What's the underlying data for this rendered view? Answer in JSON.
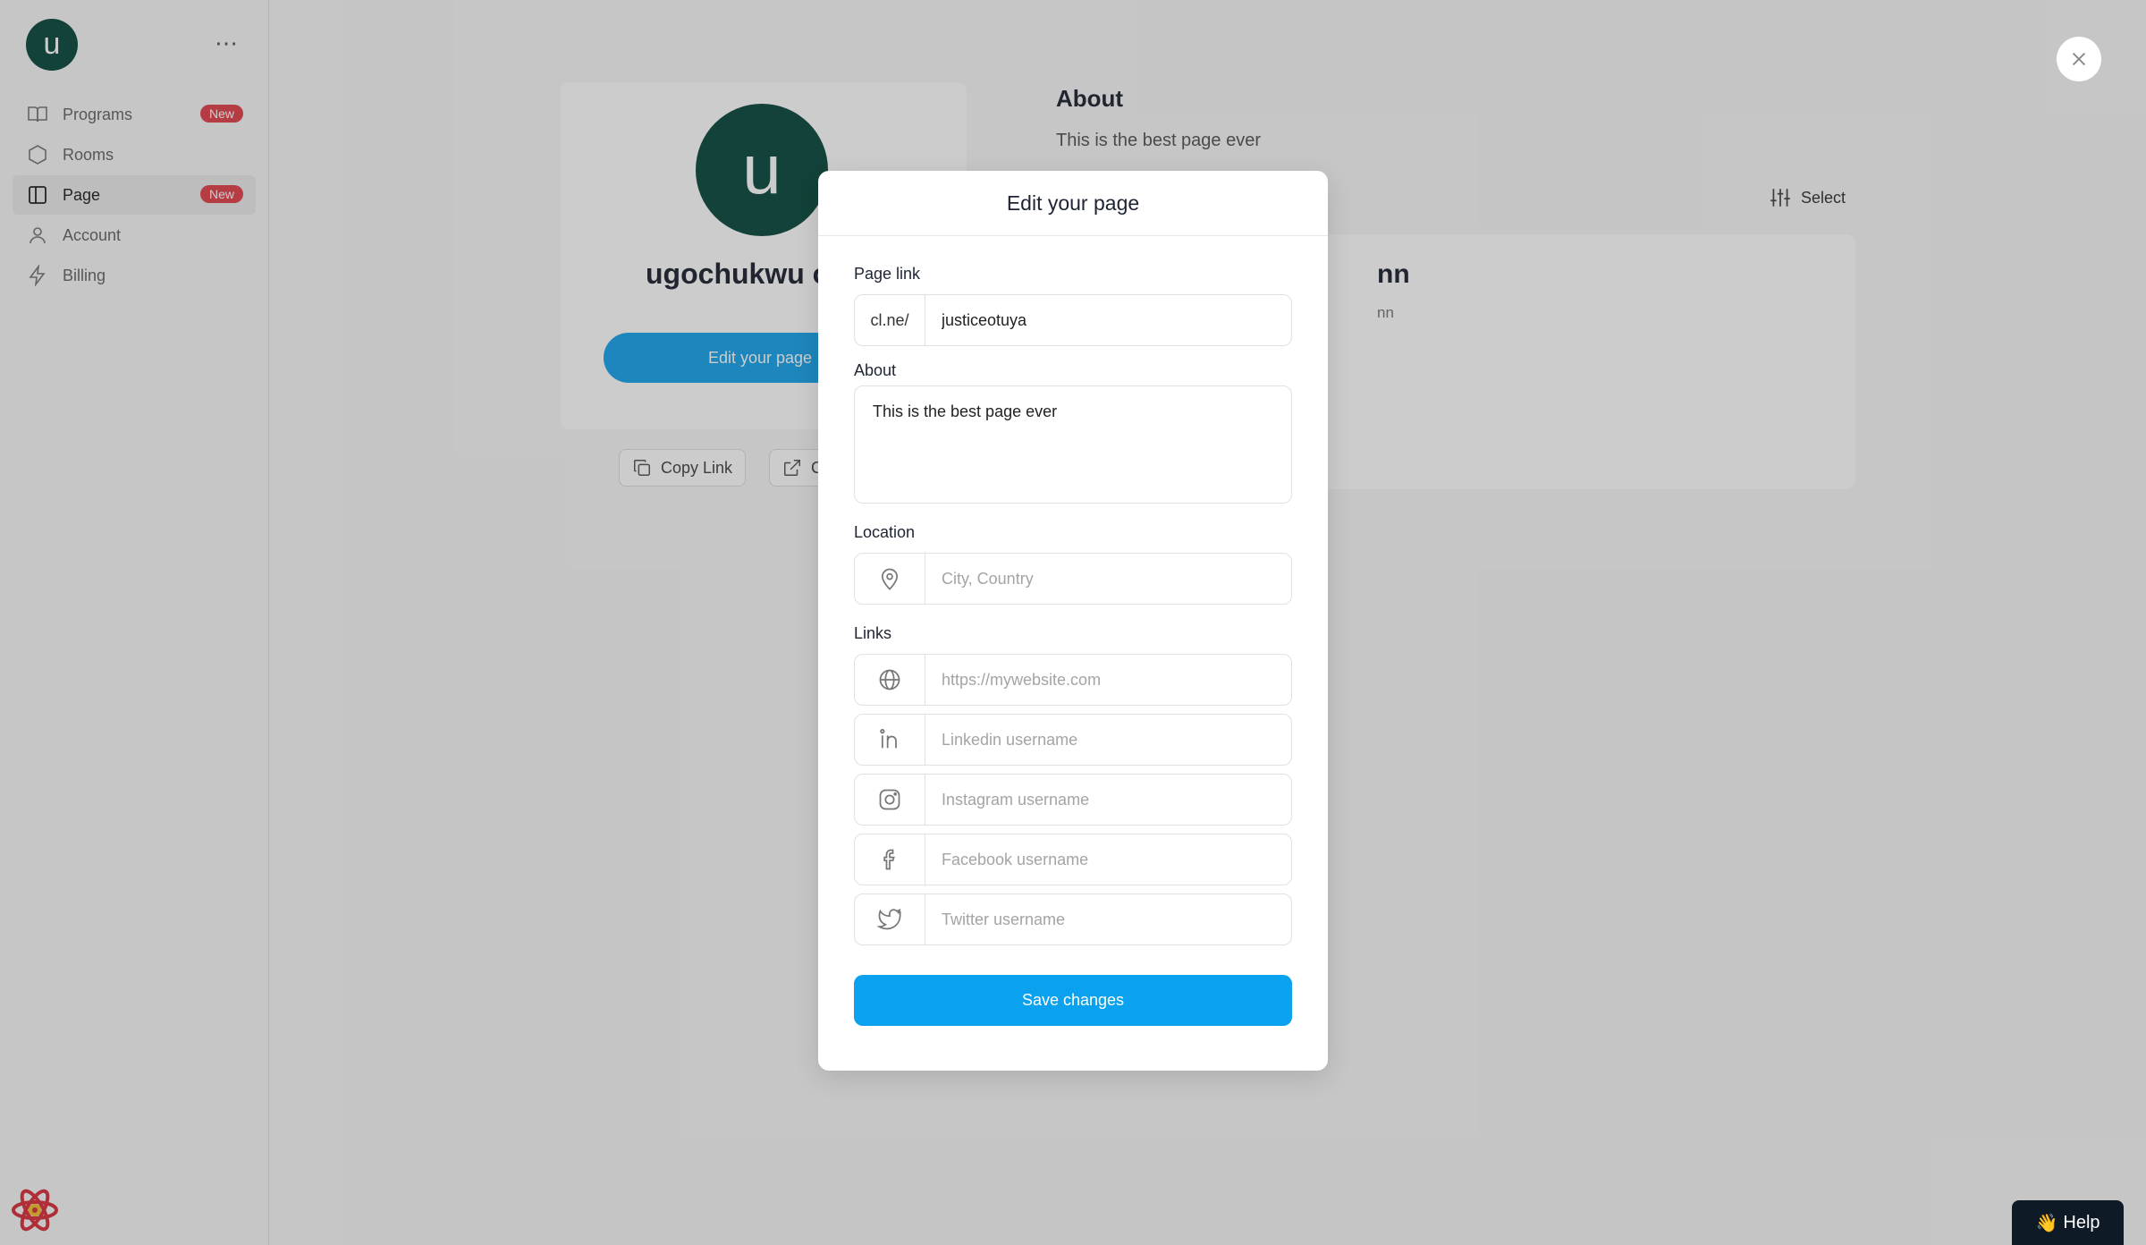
{
  "sidebar": {
    "avatar_letter": "u",
    "more_icon": "⋯",
    "items": [
      {
        "label": "Programs",
        "badge": "New"
      },
      {
        "label": "Rooms"
      },
      {
        "label": "Page",
        "badge": "New"
      },
      {
        "label": "Account"
      },
      {
        "label": "Billing"
      }
    ]
  },
  "profile": {
    "avatar_letter": "u",
    "name": "ugochukwu o",
    "edit_button": "Edit your page",
    "copy_link": "Copy Link",
    "open_partial": "C"
  },
  "about_section": {
    "heading": "About",
    "text": "This is the best page ever"
  },
  "select_button": "Select",
  "content_card": {
    "title": "nn",
    "subtitle": "nn"
  },
  "modal": {
    "title": "Edit your page",
    "page_link_label": "Page link",
    "page_link_prefix": "cl.ne/",
    "page_link_value": "justiceotuya",
    "about_label": "About",
    "about_value": "This is the best page ever",
    "location_label": "Location",
    "location_placeholder": "City, Country",
    "links_label": "Links",
    "website_placeholder": "https://mywebsite.com",
    "linkedin_placeholder": "Linkedin username",
    "instagram_placeholder": "Instagram username",
    "facebook_placeholder": "Facebook username",
    "twitter_placeholder": "Twitter username",
    "save_button": "Save changes"
  },
  "help": {
    "emoji": "👋",
    "label": "Help"
  },
  "colors": {
    "primary": "#0aa2ef",
    "avatar": "#0b4a3f",
    "badge": "#e3424d"
  }
}
